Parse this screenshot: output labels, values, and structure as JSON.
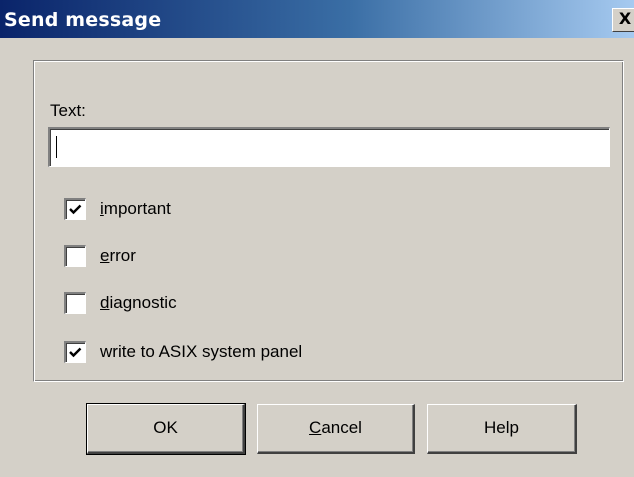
{
  "window": {
    "title": "Send message",
    "close_label": "X"
  },
  "form": {
    "text_label": "Text:",
    "text_value": ""
  },
  "checkboxes": [
    {
      "label": "important",
      "accel": "i",
      "rest": "mportant",
      "checked": true
    },
    {
      "label": "error",
      "accel": "e",
      "rest": "rror",
      "checked": false
    },
    {
      "label": "diagnostic",
      "accel": "d",
      "rest": "iagnostic",
      "checked": false
    },
    {
      "label": "write to ASIX system panel",
      "accel": "",
      "rest": "write to ASIX system panel",
      "checked": true
    }
  ],
  "buttons": {
    "ok": "OK",
    "cancel_accel": "C",
    "cancel_rest": "ancel",
    "help": "Help"
  }
}
